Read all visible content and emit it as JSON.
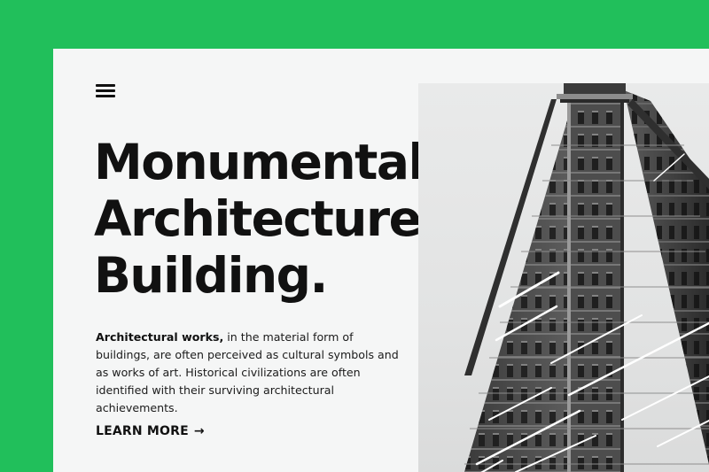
{
  "page": {
    "background_color": "#21bf5b",
    "card_color": "#f5f6f6"
  },
  "nav": {
    "menu_icon": "hamburger-menu-icon"
  },
  "hero": {
    "headline_lines": [
      "Monumental",
      "Architecture",
      "Building."
    ],
    "description_lead": "Architectural works,",
    "description_body": " in the material form of buildings, are often perceived as cultural symbols and as works of art. Historical civilizations are often identified with their surviving architectural achievements.",
    "cta_label": "LEARN MORE",
    "cta_icon": "arrow-right-icon"
  },
  "image": {
    "subject": "black-and-white photo of a flatiron skyscraper",
    "icon": "building-photo"
  }
}
